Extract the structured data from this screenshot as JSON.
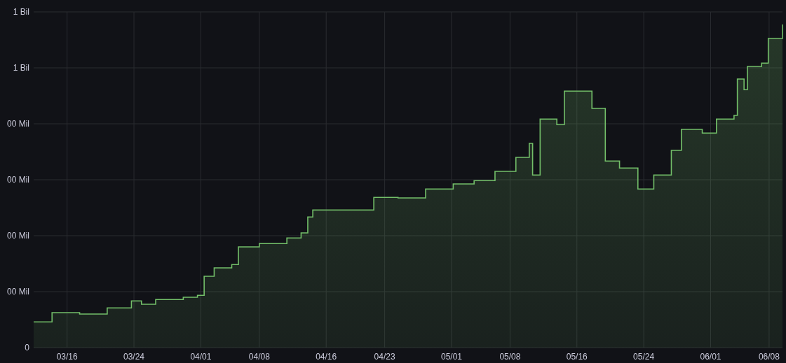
{
  "panel": {
    "y_axis_labels": [
      "1 Bil",
      "1 Bil",
      "00 Mil",
      "00 Mil",
      "00 Mil",
      "00 Mil",
      "0"
    ],
    "x_axis_labels": [
      "03/16",
      "03/24",
      "04/01",
      "04/08",
      "04/16",
      "04/23",
      "05/01",
      "05/08",
      "05/16",
      "05/24",
      "06/01",
      "06/08"
    ]
  }
}
